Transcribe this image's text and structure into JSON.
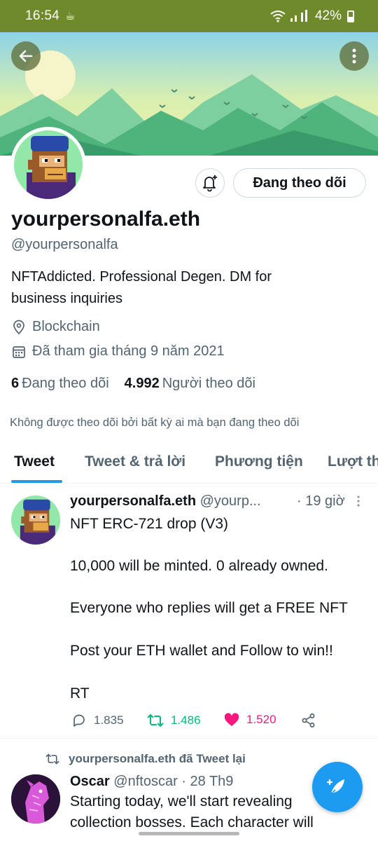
{
  "status_bar": {
    "time": "16:54",
    "battery": "42%",
    "icons": [
      "cup-icon",
      "wifi-icon",
      "signal-icon",
      "battery-icon"
    ]
  },
  "header": {
    "back_icon": "arrow-left-icon",
    "more_icon": "more-vertical-icon"
  },
  "profile": {
    "display_name": "yourpersonalfa.eth",
    "handle": "@yourpersonalfa",
    "bio_line1": "NFTAddicted. Professional Degen. DM for",
    "bio_line2": "business inquiries",
    "location": "Blockchain",
    "joined": "Đã tham gia tháng 9 năm 2021",
    "following_count": "6",
    "following_label": "Đang theo dõi",
    "followers_count": "4.992",
    "followers_label": "Người theo dõi",
    "not_followed_note": "Không được theo dõi bởi bất kỳ ai mà bạn đang theo dõi",
    "follow_button": "Đang theo dõi",
    "bell_icon": "notification-bell-plus-icon"
  },
  "tabs": [
    {
      "label": "Tweet",
      "active": true
    },
    {
      "label": "Tweet & trả lời",
      "active": false
    },
    {
      "label": "Phương tiện",
      "active": false
    },
    {
      "label": "Lượt th",
      "active": false
    }
  ],
  "tweet1": {
    "name": "yourpersonalfa.eth",
    "handle": "@yourp...",
    "time": "· 19 giờ",
    "lines": [
      "NFT ERC-721 drop (V3)",
      "",
      "10,000 will be minted. 0 already owned.",
      "",
      "Everyone who replies will get a FREE NFT",
      "",
      "Post your ETH wallet and Follow to win!!",
      "",
      "RT"
    ],
    "replies": "1.835",
    "retweets": "1.486",
    "likes": "1.520"
  },
  "tweet2": {
    "retweet_label": "yourpersonalfa.eth đã Tweet lại",
    "name": "Oscar",
    "handle": "@nftoscar",
    "time": "· 28 Th9",
    "line1": "Starting today, we'll start revealing",
    "line2": "collection bosses. Each character will"
  },
  "colors": {
    "accent": "#1d9bf0",
    "status_bar": "#6f8a2a",
    "retweet": "#00ba7c",
    "like": "#f91880",
    "muted": "#536471"
  }
}
